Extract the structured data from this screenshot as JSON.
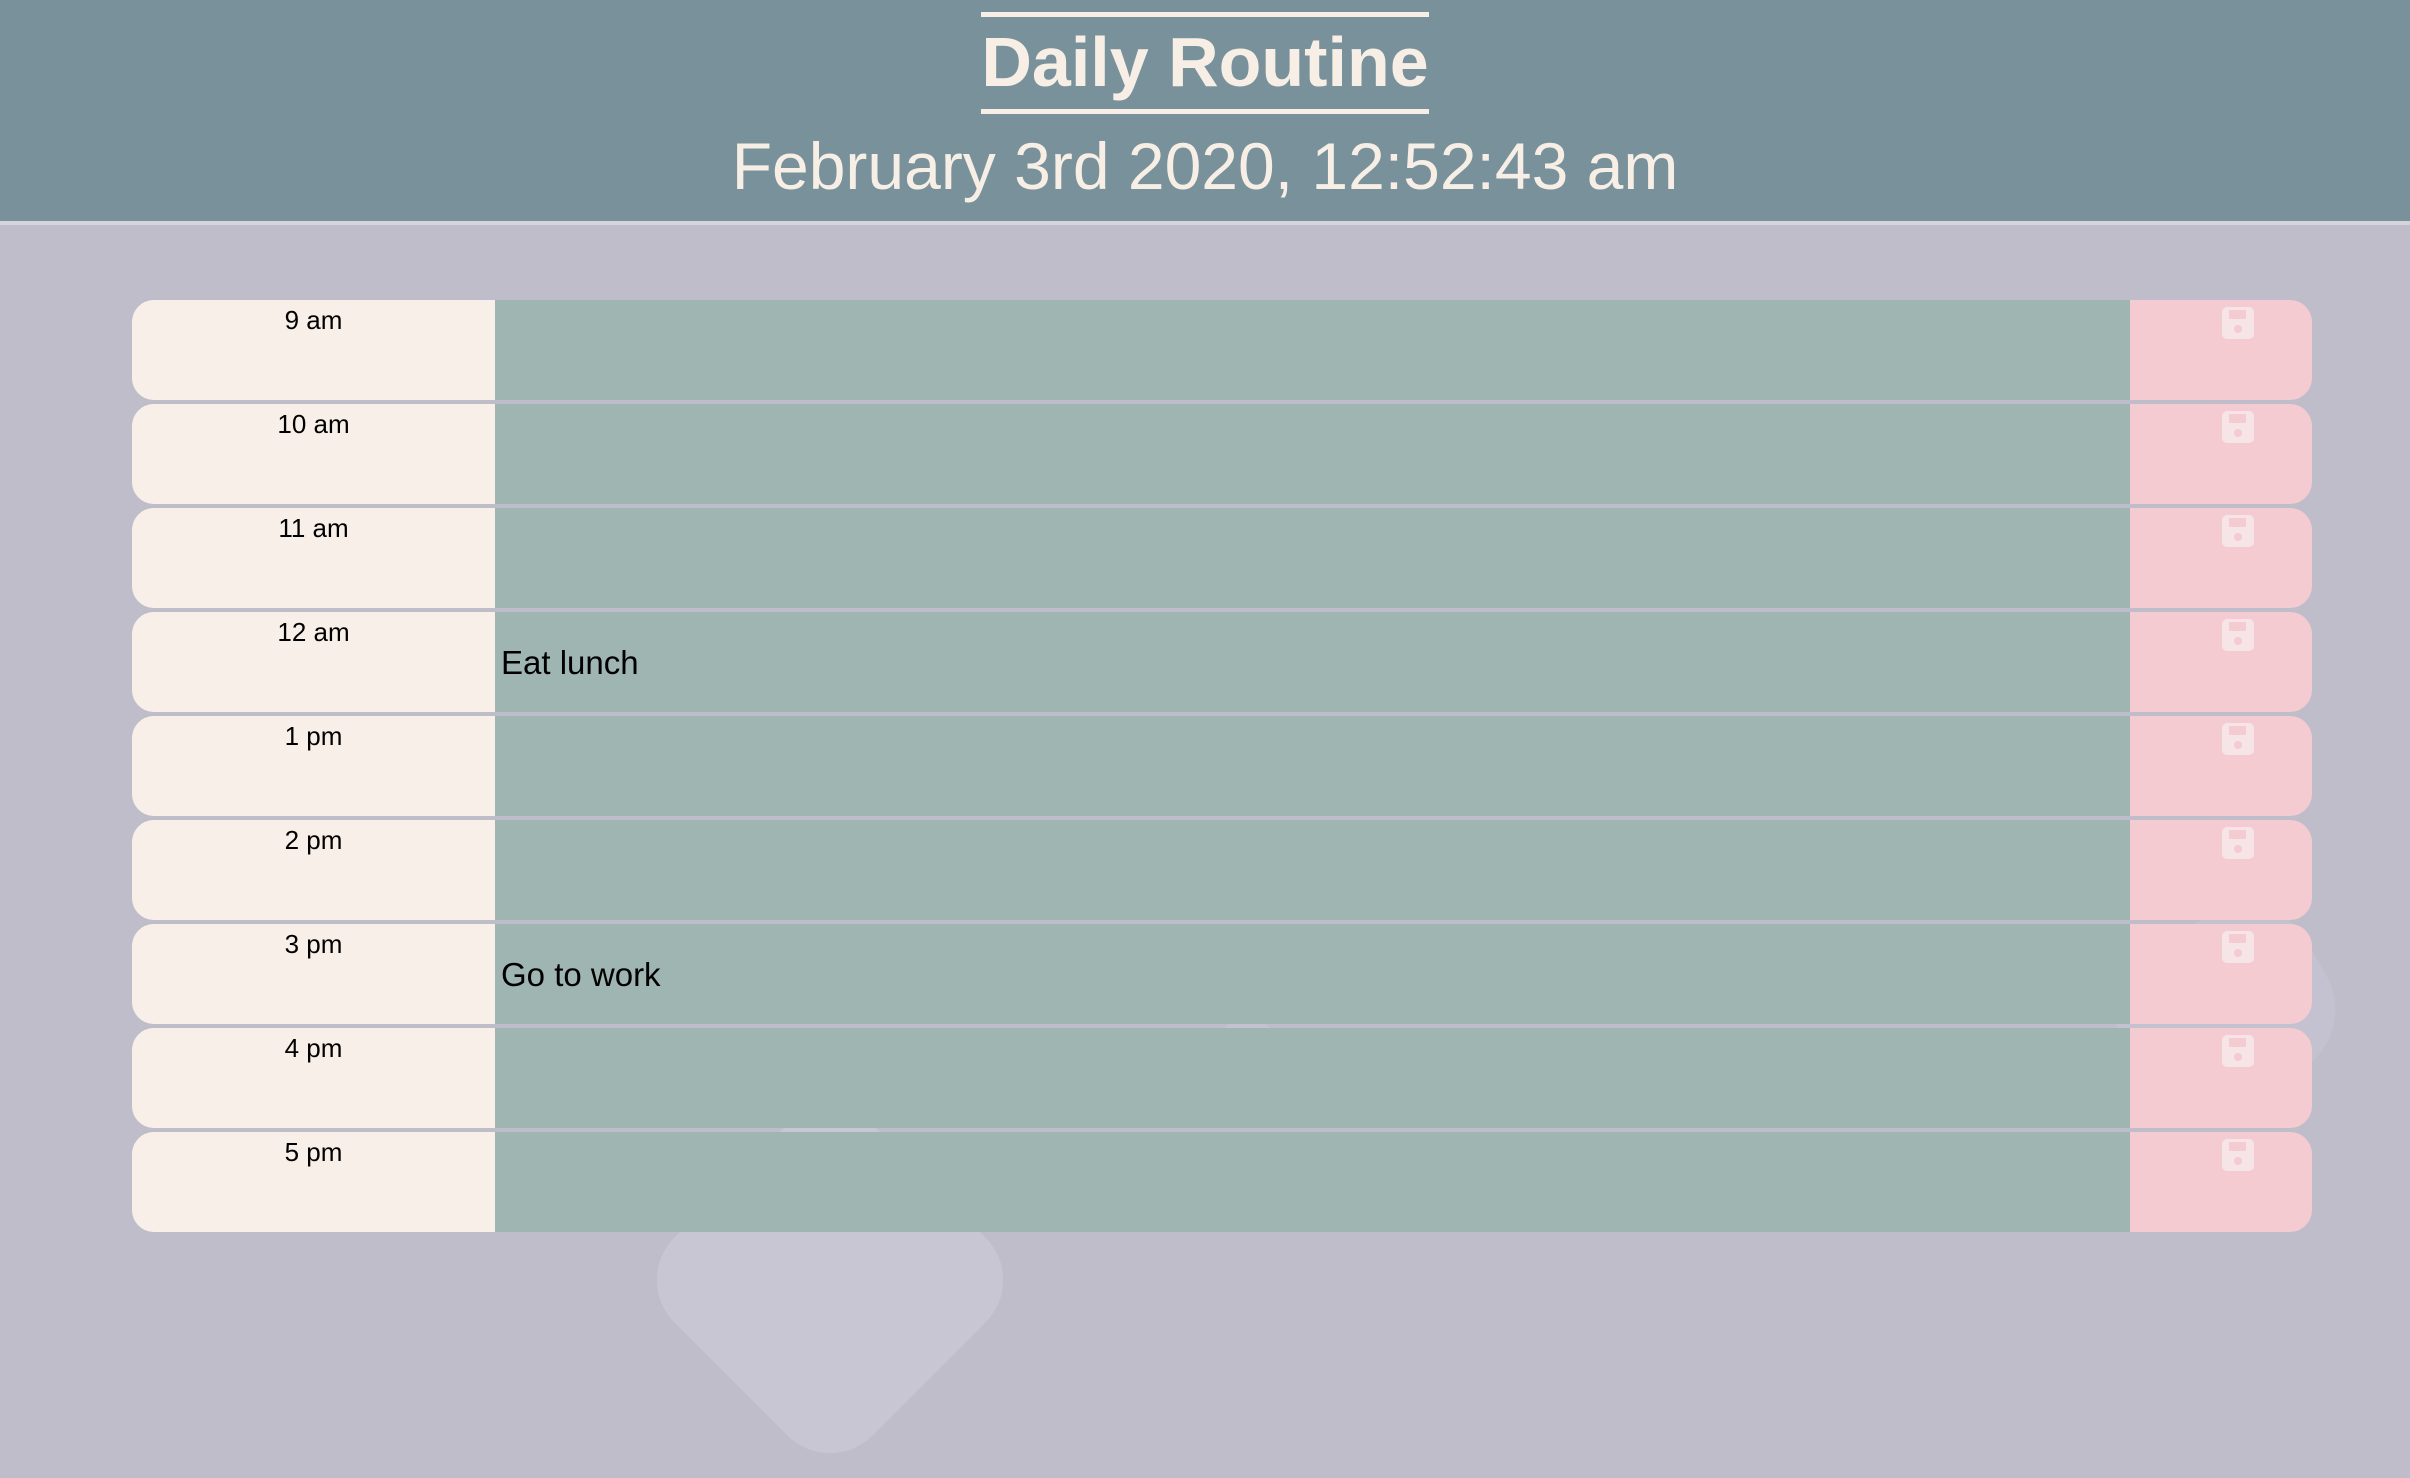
{
  "header": {
    "title": "Daily Routine",
    "datetime": "February 3rd 2020, 12:52:43 am"
  },
  "colors": {
    "header_bg": "#79919a",
    "page_bg": "#bfbdca",
    "hour_bg": "#f8f0e8",
    "task_bg": "#9fb5b1",
    "save_bg": "#f3cbd1",
    "text_light": "#f7efe6"
  },
  "timeblocks": [
    {
      "hour": "9 am",
      "task": ""
    },
    {
      "hour": "10 am",
      "task": ""
    },
    {
      "hour": "11 am",
      "task": ""
    },
    {
      "hour": "12 am",
      "task": "Eat lunch"
    },
    {
      "hour": "1 pm",
      "task": ""
    },
    {
      "hour": "2 pm",
      "task": ""
    },
    {
      "hour": "3 pm",
      "task": "Go to work"
    },
    {
      "hour": "4 pm",
      "task": ""
    },
    {
      "hour": "5 pm",
      "task": ""
    }
  ],
  "icons": {
    "save": "floppy-disk-icon"
  }
}
